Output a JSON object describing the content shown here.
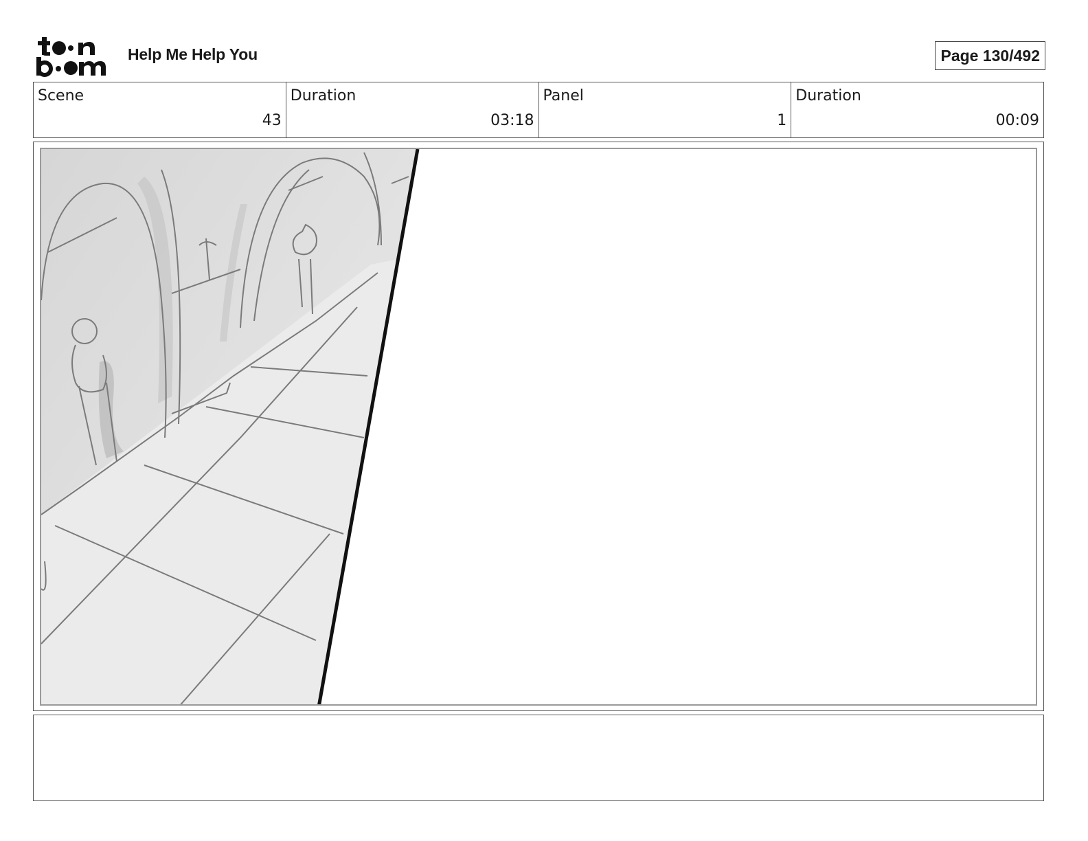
{
  "header": {
    "logo_text": "toon boom",
    "project_title": "Help Me Help You",
    "page_indicator": "Page 130/492"
  },
  "info": {
    "scene_label": "Scene",
    "scene_value": "43",
    "scene_duration_label": "Duration",
    "scene_duration_value": "03:18",
    "panel_label": "Panel",
    "panel_value": "1",
    "panel_duration_label": "Duration",
    "panel_duration_value": "00:09"
  },
  "panel": {
    "image_description_icon": "storyboard-sketch-hallway-arches"
  },
  "notes": {
    "text": ""
  }
}
